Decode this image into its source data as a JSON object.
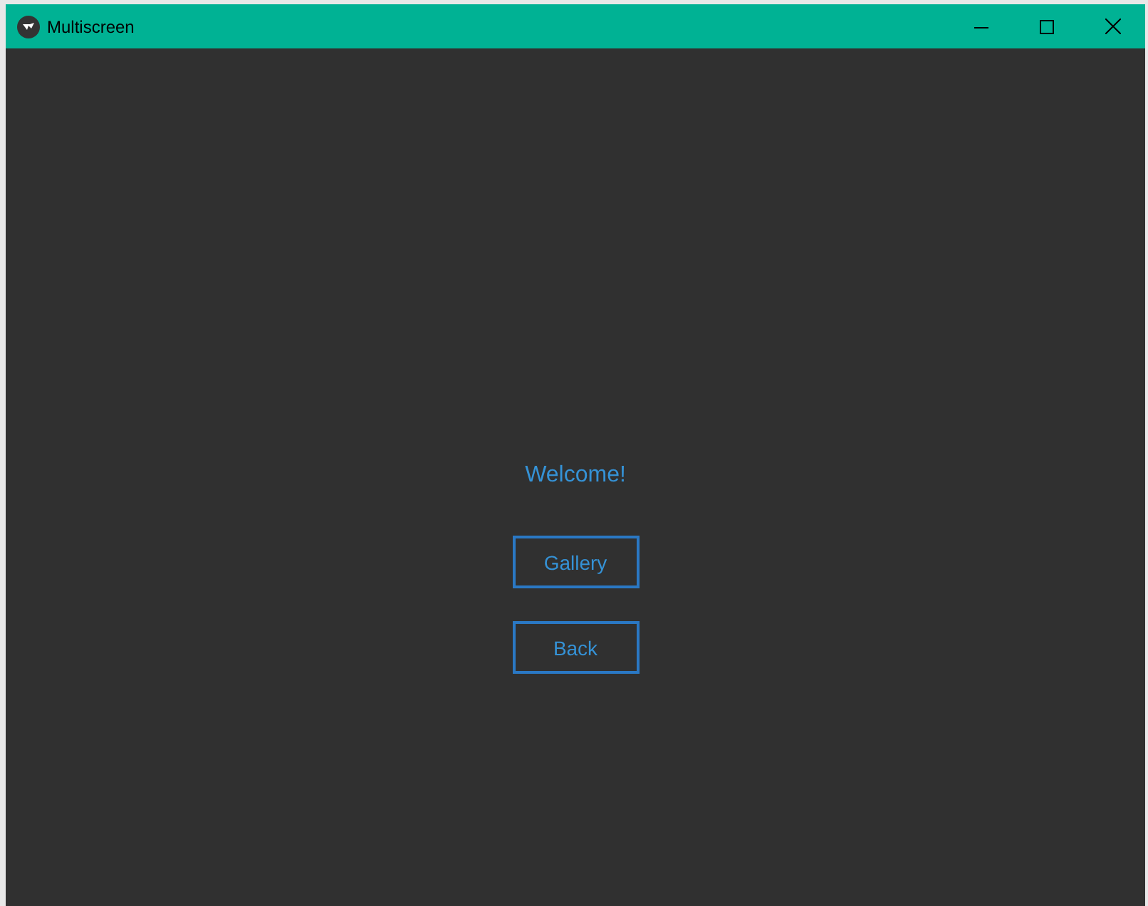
{
  "window": {
    "title": "Multiscreen"
  },
  "welcome": "Welcome!",
  "buttons": [
    {
      "label": "Gallery"
    },
    {
      "label": "Back"
    }
  ]
}
